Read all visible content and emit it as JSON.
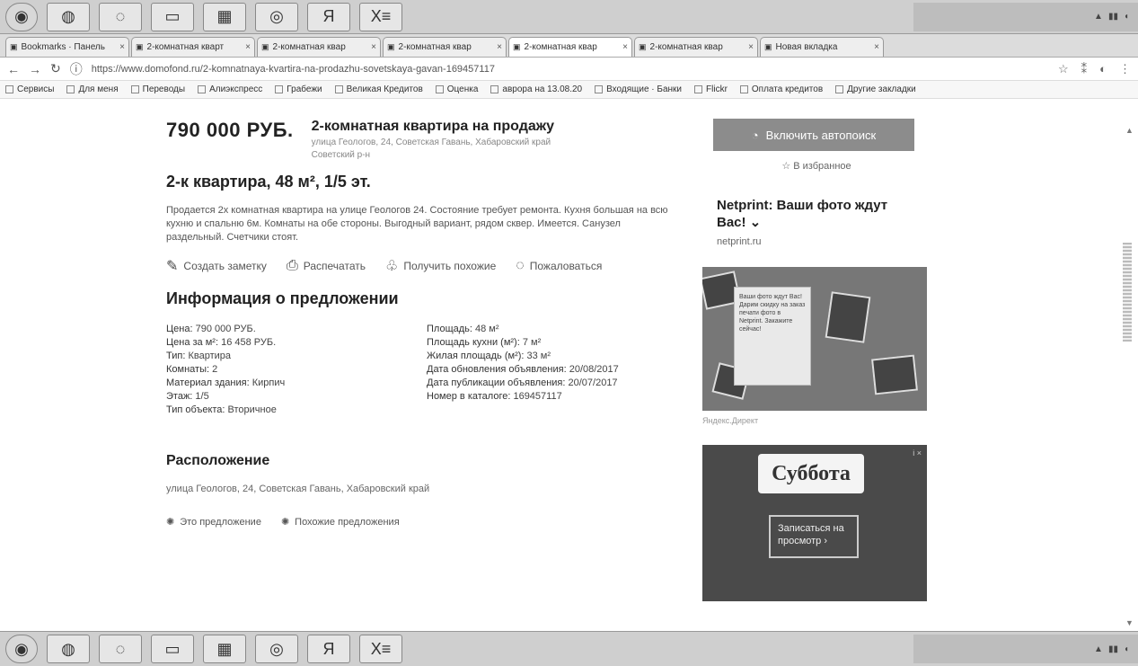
{
  "taskbar": {
    "buttons": [
      {
        "name": "start-icon",
        "glyph": "◉"
      },
      {
        "name": "browser-icon",
        "glyph": "◍"
      },
      {
        "name": "explorer-icon",
        "glyph": "◌"
      },
      {
        "name": "folder-icon",
        "glyph": "▭"
      },
      {
        "name": "media-icon",
        "glyph": "▦"
      },
      {
        "name": "chrome-icon",
        "glyph": "◎"
      },
      {
        "name": "yandex-icon",
        "glyph": "Я"
      },
      {
        "name": "excel-icon",
        "glyph": "X≡"
      }
    ]
  },
  "tabs": [
    {
      "label": "Bookmarks · Панель",
      "active": false
    },
    {
      "label": "2-комнатная кварт",
      "active": false
    },
    {
      "label": "2-комнатная квар",
      "active": false
    },
    {
      "label": "2-комнатная квар",
      "active": false
    },
    {
      "label": "2-комнатная квар",
      "active": true
    },
    {
      "label": "2-комнатная квар",
      "active": false
    },
    {
      "label": "Новая вкладка",
      "active": false
    }
  ],
  "addressbar": {
    "url": "https://www.domofond.ru/2-komnatnaya-kvartira-na-prodazhu-sovetskaya-gavan-169457117"
  },
  "bookmarks": [
    {
      "label": "Сервисы"
    },
    {
      "label": "Для меня"
    },
    {
      "label": "Переводы"
    },
    {
      "label": "Алиэкспресс"
    },
    {
      "label": "Грабежи"
    },
    {
      "label": "Великая Кредитов"
    },
    {
      "label": "Оценка"
    },
    {
      "label": "аврора на 13.08.20"
    },
    {
      "label": "Входящие · Банки"
    },
    {
      "label": "Flickr"
    },
    {
      "label": "Оплата кредитов"
    },
    {
      "label": "Другие закладки"
    }
  ],
  "listing": {
    "price": "790 000 РУБ.",
    "title": "2-комнатная квартира на продажу",
    "address_line": "улица Геологов, 24, Советская Гавань, Хабаровский край",
    "district": "Советский р-н",
    "heading": "2-к квартира, 48 м², 1/5 эт.",
    "description": "Продается 2х комнатная квартира на улице Геологов 24. Состояние требует ремонта. Кухня большая на всю кухню и спальню 6м. Комнаты на обе стороны. Выгодный вариант, рядом сквер. Имеется. Санузел раздельный. Счетчики стоят.",
    "actions": [
      {
        "icon": "✎",
        "label": "Создать заметку"
      },
      {
        "icon": "⎙",
        "label": "Распечатать"
      },
      {
        "icon": "♧",
        "label": "Получить похожие"
      },
      {
        "icon": "◌",
        "label": "Пожаловаться"
      }
    ]
  },
  "info": {
    "title": "Информация о предложении",
    "left": [
      {
        "k": "Цена:",
        "v": "790 000 РУБ."
      },
      {
        "k": "Цена за м²:",
        "v": "16 458 РУБ."
      },
      {
        "k": "Тип:",
        "v": "Квартира"
      },
      {
        "k": "Комнаты:",
        "v": "2"
      },
      {
        "k": "Материал здания:",
        "v": "Кирпич"
      },
      {
        "k": "Этаж:",
        "v": "1/5"
      },
      {
        "k": "Тип объекта:",
        "v": "Вторичное"
      }
    ],
    "right": [
      {
        "k": "Площадь:",
        "v": "48 м²"
      },
      {
        "k": "Площадь кухни (м²):",
        "v": "7 м²"
      },
      {
        "k": "Жилая площадь (м²):",
        "v": "33 м²"
      },
      {
        "k": "Дата обновления объявления:",
        "v": "20/08/2017"
      },
      {
        "k": "Дата публикации объявления:",
        "v": "20/07/2017"
      },
      {
        "k": "Номер в каталоге:",
        "v": "169457117"
      }
    ]
  },
  "location": {
    "title": "Расположение",
    "address": "улица Геологов, 24, Советская Гавань, Хабаровский край",
    "links": [
      {
        "label": "Это предложение"
      },
      {
        "label": "Похожие предложения"
      }
    ]
  },
  "sidebar": {
    "notify_label": "Включить автопоиск",
    "favorite_label": "В избранное",
    "ad_title": "Netprint: Ваши фото ждут Вас! ⌄",
    "ad_domain": "netprint.ru",
    "ad_card_text": "Ваши фото ждут Вас! Дарим скидку на заказ печати фото в Netprint. Закажите сейчас!",
    "ad_caption": "Яндекс.Директ",
    "banner_logo": "Суббота",
    "banner_cta": "Записаться на просмотр ›",
    "banner_info": "i ×"
  }
}
